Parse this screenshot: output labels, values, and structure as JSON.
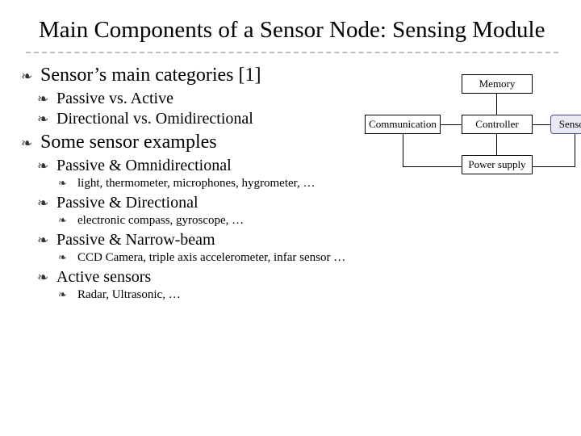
{
  "title": "Main Components of a Sensor Node: Sensing Module",
  "sections": {
    "categories": {
      "heading": "Sensor’s main categories [1]",
      "items": {
        "i1": "Passive vs. Active",
        "i2": "Directional  vs. Omidirectional"
      }
    },
    "examples": {
      "heading": "Some sensor examples",
      "omni": {
        "label": "Passive & Omnidirectional",
        "detail": "light, thermometer, microphones, hygrometer,  …"
      },
      "directional": {
        "label": "Passive & Directional",
        "detail": "electronic compass, gyroscope, …"
      },
      "narrow": {
        "label": "Passive & Narrow-beam",
        "detail": "CCD Camera, triple axis accelerometer, infar sensor …"
      },
      "active": {
        "label": "Active sensors",
        "detail": "Radar, Ultrasonic, …"
      }
    }
  },
  "diagram": {
    "memory": "Memory",
    "communication": "Communication",
    "controller": "Controller",
    "sensors": "Sensors",
    "power": "Power supply"
  }
}
